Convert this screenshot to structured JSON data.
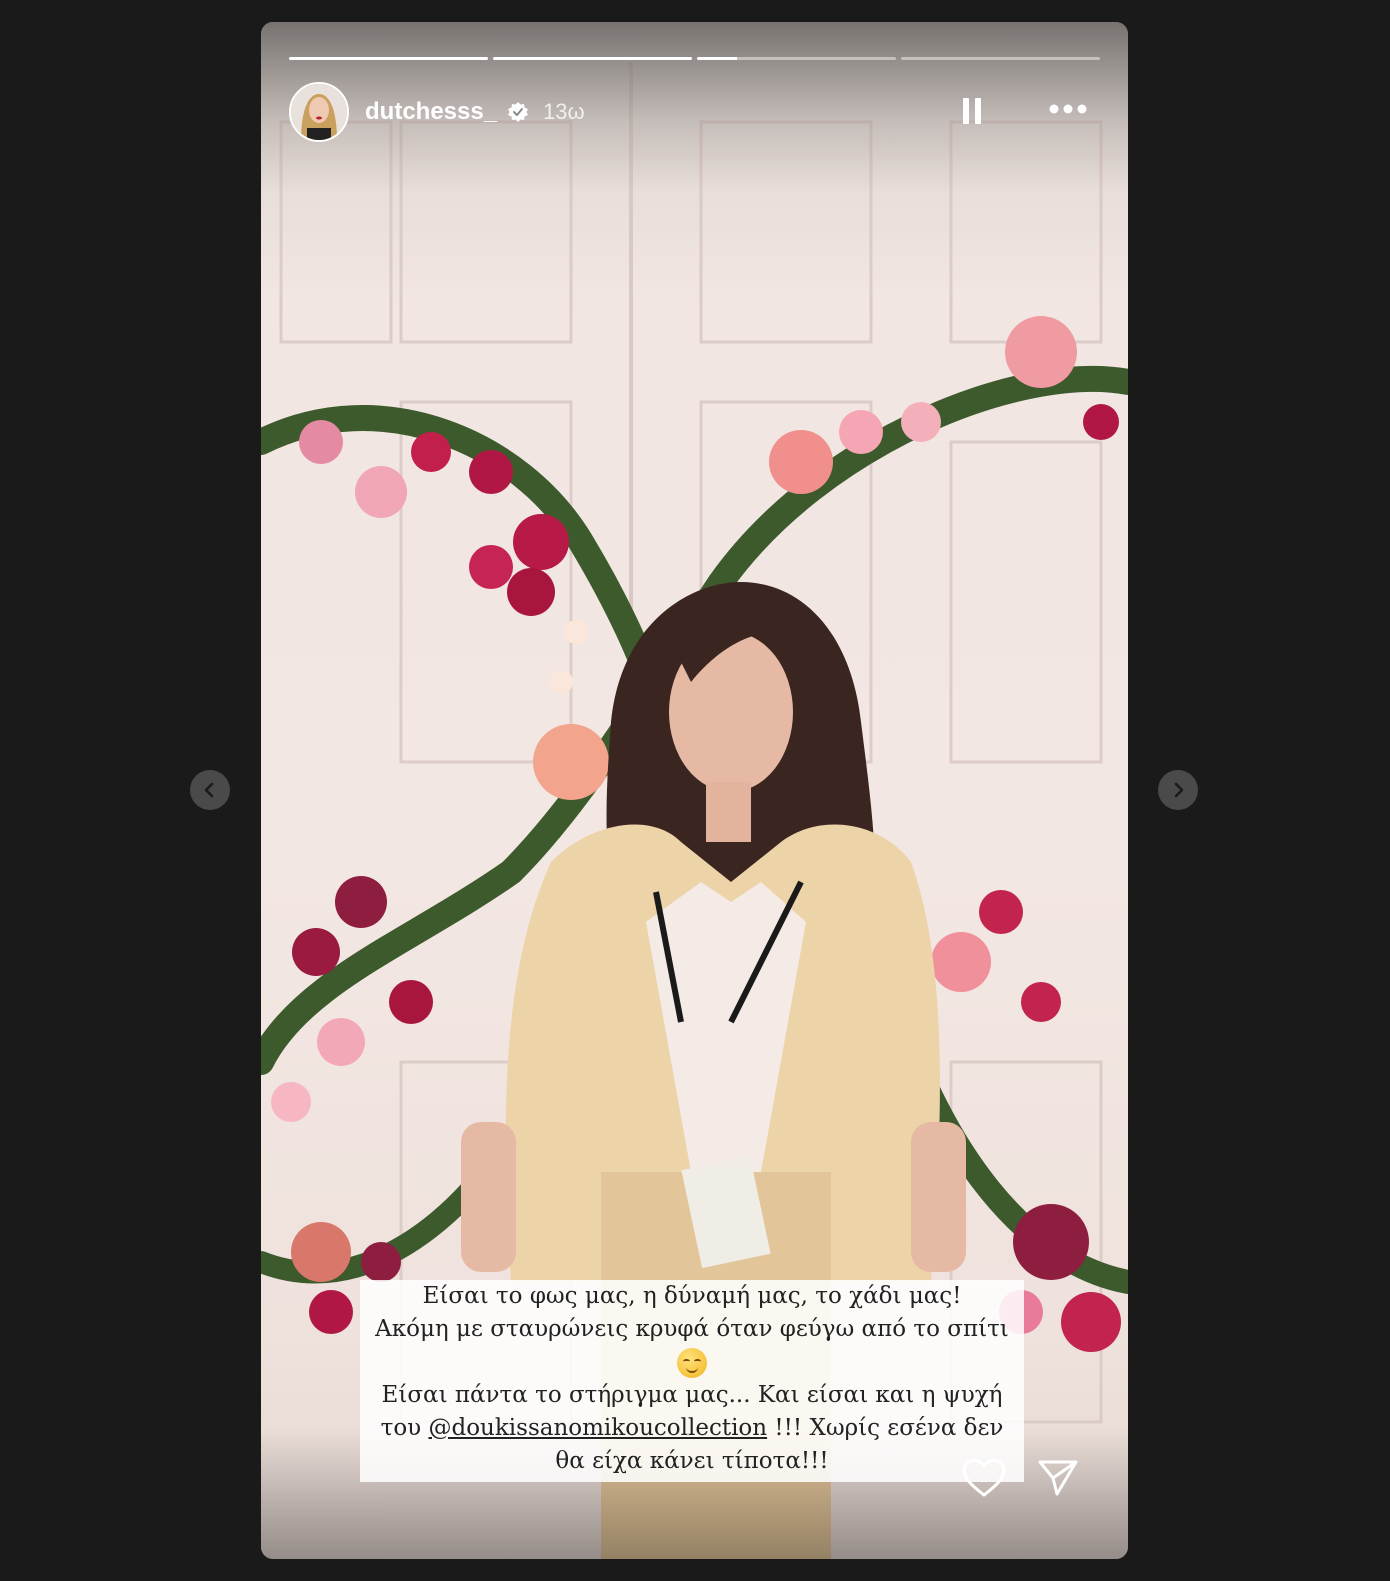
{
  "story": {
    "progress": [
      1,
      1,
      0.2,
      0
    ],
    "user": {
      "username": "dutchesss_",
      "verified": true,
      "time_ago": "13ω"
    },
    "caption": {
      "line1": "Είσαι το φως μας, η δύναμή μας, το χάδι μας!",
      "line2": "Ακόμη με σταυρώνεις κρυφά όταν φεύγω από το σπίτι",
      "emoji": "relieved-face-emoji",
      "line3": "Είσαι πάντα το στήριγμα μας... Και είσαι και η ψυχή",
      "line4_prefix": "του ",
      "mention": "@doukissanomikoucollection",
      "line4_suffix": " !!! Χωρίς εσένα δεν",
      "line5": "θα είχα κάνει τίποτα!!!"
    },
    "icons": {
      "pause": "pause-icon",
      "more": "more-options-icon",
      "prev": "chevron-left-icon",
      "next": "chevron-right-icon",
      "like": "heart-icon",
      "share": "send-icon"
    }
  }
}
